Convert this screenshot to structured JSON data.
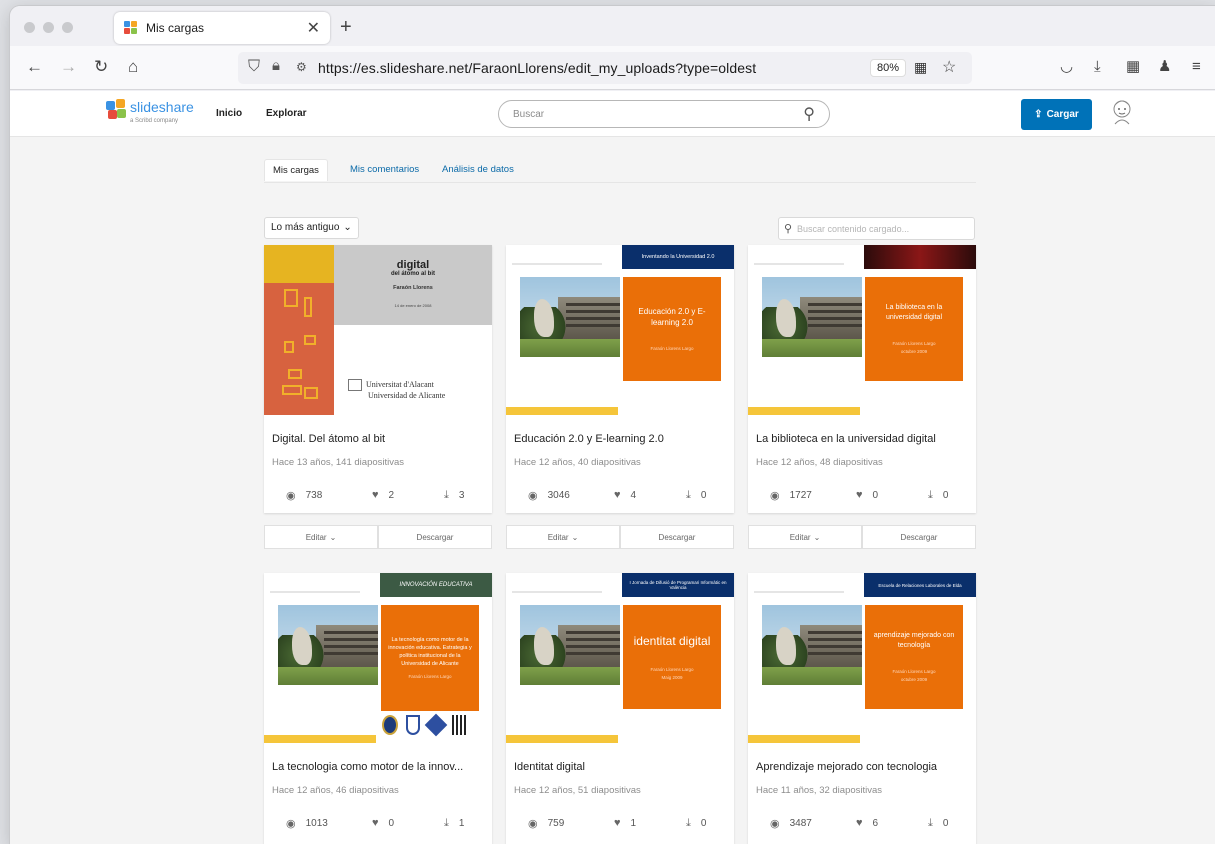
{
  "browser": {
    "tab_title": "Mis cargas",
    "url": "https://es.slideshare.net/FaraonLlorens/edit_my_uploads?type=oldest",
    "zoom": "80%"
  },
  "header": {
    "logo_word": "slideshare",
    "logo_sub": "a Scribd company",
    "nav_inicio": "Inicio",
    "nav_explorar": "Explorar",
    "search_placeholder": "Buscar",
    "upload_label": "Cargar"
  },
  "subtabs": [
    "Mis cargas",
    "Mis comentarios",
    "Análisis de datos"
  ],
  "sort_label": "Lo más antiguo",
  "filter_placeholder": "Buscar contenido cargado...",
  "card_actions": {
    "edit": "Editar",
    "download": "Descargar"
  },
  "thumbs": {
    "t1_h": "digital",
    "t1_h2": "del átomo al bit",
    "t1_author": "Faraón Llorens",
    "t1_date": "14 de enero de 2008",
    "t1_ua1": "Universitat d'Alacant",
    "t1_ua2": "Universidad de Alicante",
    "t2_banner": "Inventando la Universidad 2.0",
    "t2_box": "Educación 2.0 y E-learning 2.0",
    "t2_author": "Faraón Llorens Largo",
    "t3_box": "La biblioteca en la universidad digital",
    "t3_author": "Faraón Llorens Largo",
    "t3_date": "octubre 2009",
    "t4_banner": "INNOVACIÓN EDUCATIVA",
    "t4_box": "La tecnología como motor de la innovación educativa. Estrategia y política institucional de la Universidad de Alicante",
    "t4_author": "Faraón Llorens Largo",
    "t5_banner": "I Jornada de Difusió de Programari Informàtic en València",
    "t5_box": "identitat digital",
    "t5_author": "Faraón Llorens Largo",
    "t5_date": "Maig 2009",
    "t6_banner": "Escuela de Relaciones Laborales de Elda",
    "t6_box": "aprendizaje mejorado con tecnología",
    "t6_author": "Faraón Llorens Largo",
    "t6_date": "octubre 2009"
  },
  "cards": [
    {
      "title": "Digital. Del átomo al bit",
      "meta": "Hace 13 años, 141 diapositivas",
      "views": "738",
      "likes": "2",
      "downloads": "3"
    },
    {
      "title": "Educación 2.0 y E-learning 2.0",
      "meta": "Hace 12 años, 40 diapositivas",
      "views": "3046",
      "likes": "4",
      "downloads": "0"
    },
    {
      "title": "La biblioteca en la universidad digital",
      "meta": "Hace 12 años, 48 diapositivas",
      "views": "1727",
      "likes": "0",
      "downloads": "0"
    },
    {
      "title": "La tecnologia como motor de la innov...",
      "meta": "Hace 12 años, 46 diapositivas",
      "views": "1013",
      "likes": "0",
      "downloads": "1"
    },
    {
      "title": "Identitat digital",
      "meta": "Hace 12 años, 51 diapositivas",
      "views": "759",
      "likes": "1",
      "downloads": "0"
    },
    {
      "title": "Aprendizaje mejorado con tecnologia",
      "meta": "Hace 11 años, 32 diapositivas",
      "views": "3487",
      "likes": "6",
      "downloads": "0"
    }
  ],
  "colors": {
    "accent": "#0072b8",
    "link": "#0b6aa8",
    "slide_orange": "#ea6f08",
    "banner_navy": "#0a2f6b"
  }
}
